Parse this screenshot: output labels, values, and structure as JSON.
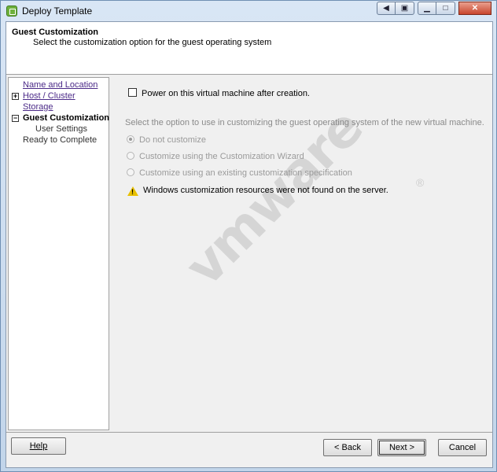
{
  "window": {
    "title": "Deploy Template"
  },
  "titlebar_buttons": [
    {
      "icon": "back-icon"
    },
    {
      "icon": "restore-icon"
    },
    {
      "icon": "minimize-icon"
    },
    {
      "icon": "maximize-icon"
    },
    {
      "icon": "close-icon"
    }
  ],
  "header": {
    "title": "Guest Customization",
    "subtitle": "Select the customization option for the guest operating system"
  },
  "nav": {
    "items": [
      {
        "label": "Name and Location",
        "state": "link"
      },
      {
        "label": "Host / Cluster",
        "state": "link",
        "expander": "+"
      },
      {
        "label": "Storage",
        "state": "link"
      },
      {
        "label": "Guest Customization",
        "state": "current",
        "expander": "−"
      },
      {
        "label": "User Settings",
        "state": "plain",
        "indent": true
      },
      {
        "label": "Ready to Complete",
        "state": "plain"
      }
    ]
  },
  "content": {
    "power_on_label": "Power on this virtual machine after creation.",
    "power_on_checked": false,
    "prompt": "Select the option to use in customizing the guest operating system of the new virtual machine.",
    "options": [
      {
        "label": "Do not customize",
        "selected": true,
        "enabled": false
      },
      {
        "label": "Customize using the Customization Wizard",
        "selected": false,
        "enabled": false
      },
      {
        "label": "Customize using an existing customization specification",
        "selected": false,
        "enabled": false
      }
    ],
    "warning": "Windows customization resources were not found on the server.",
    "watermark": "vmware",
    "watermark_reg": "®"
  },
  "footer": {
    "help": "Help",
    "back": "< Back",
    "next": "Next >",
    "cancel": "Cancel"
  }
}
